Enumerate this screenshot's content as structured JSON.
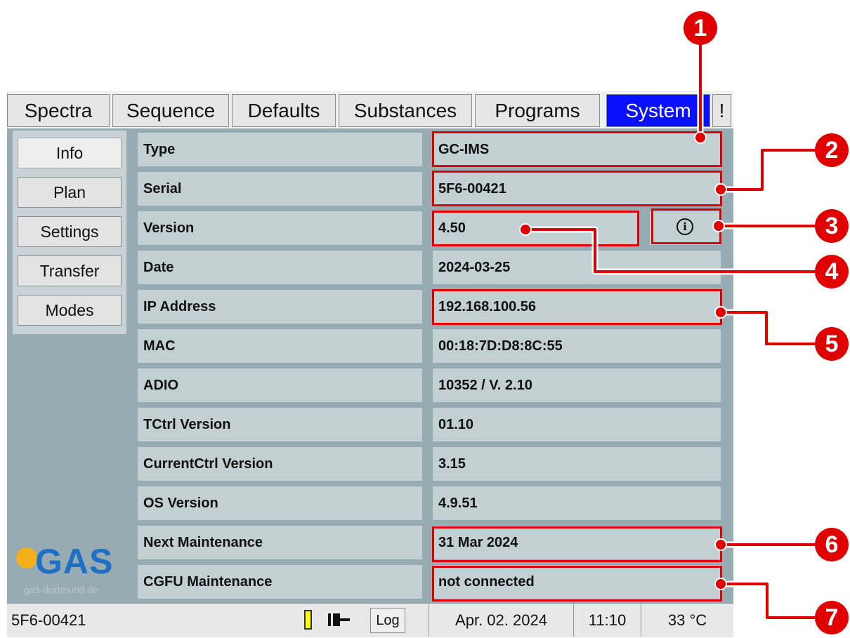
{
  "tabs": [
    "Spectra",
    "Sequence",
    "Defaults",
    "Substances",
    "Programs",
    "System",
    "!"
  ],
  "active_tab": "System",
  "sidebar": [
    "Info",
    "Plan",
    "Settings",
    "Transfer",
    "Modes"
  ],
  "selected_sidebar": "Info",
  "rows": [
    {
      "label": "Type",
      "value": "GC-IMS"
    },
    {
      "label": "Serial",
      "value": "5F6-00421"
    },
    {
      "label": "Version",
      "value": "4.50"
    },
    {
      "label": "Date",
      "value": "2024-03-25"
    },
    {
      "label": "IP Address",
      "value": "192.168.100.56"
    },
    {
      "label": "MAC",
      "value": "00:18:7D:D8:8C:55"
    },
    {
      "label": "ADIO",
      "value": "10352 / V. 2.10"
    },
    {
      "label": "TCtrl Version",
      "value": "01.10"
    },
    {
      "label": "CurrentCtrl Version",
      "value": "3.15"
    },
    {
      "label": "OS Version",
      "value": "4.9.51"
    },
    {
      "label": "Next Maintenance",
      "value": "31 Mar 2024"
    },
    {
      "label": "CGFU Maintenance",
      "value": "not connected"
    }
  ],
  "info_icon": "info-icon",
  "logo": {
    "word": "GAS",
    "sub": "gas-dortmund.de"
  },
  "status": {
    "serial": "5F6-00421",
    "log_label": "Log",
    "date": "Apr. 02. 2024",
    "time": "11:10",
    "temperature": "33 °C",
    "battery_icon": "battery-icon",
    "plug_icon": "plug-icon"
  },
  "callouts": [
    "1",
    "2",
    "3",
    "4",
    "5",
    "6",
    "7"
  ],
  "colors": {
    "accent": "#0a10ff",
    "annotation": "#e10000",
    "panel": "#97abb2",
    "cell": "#c2d0d4"
  }
}
